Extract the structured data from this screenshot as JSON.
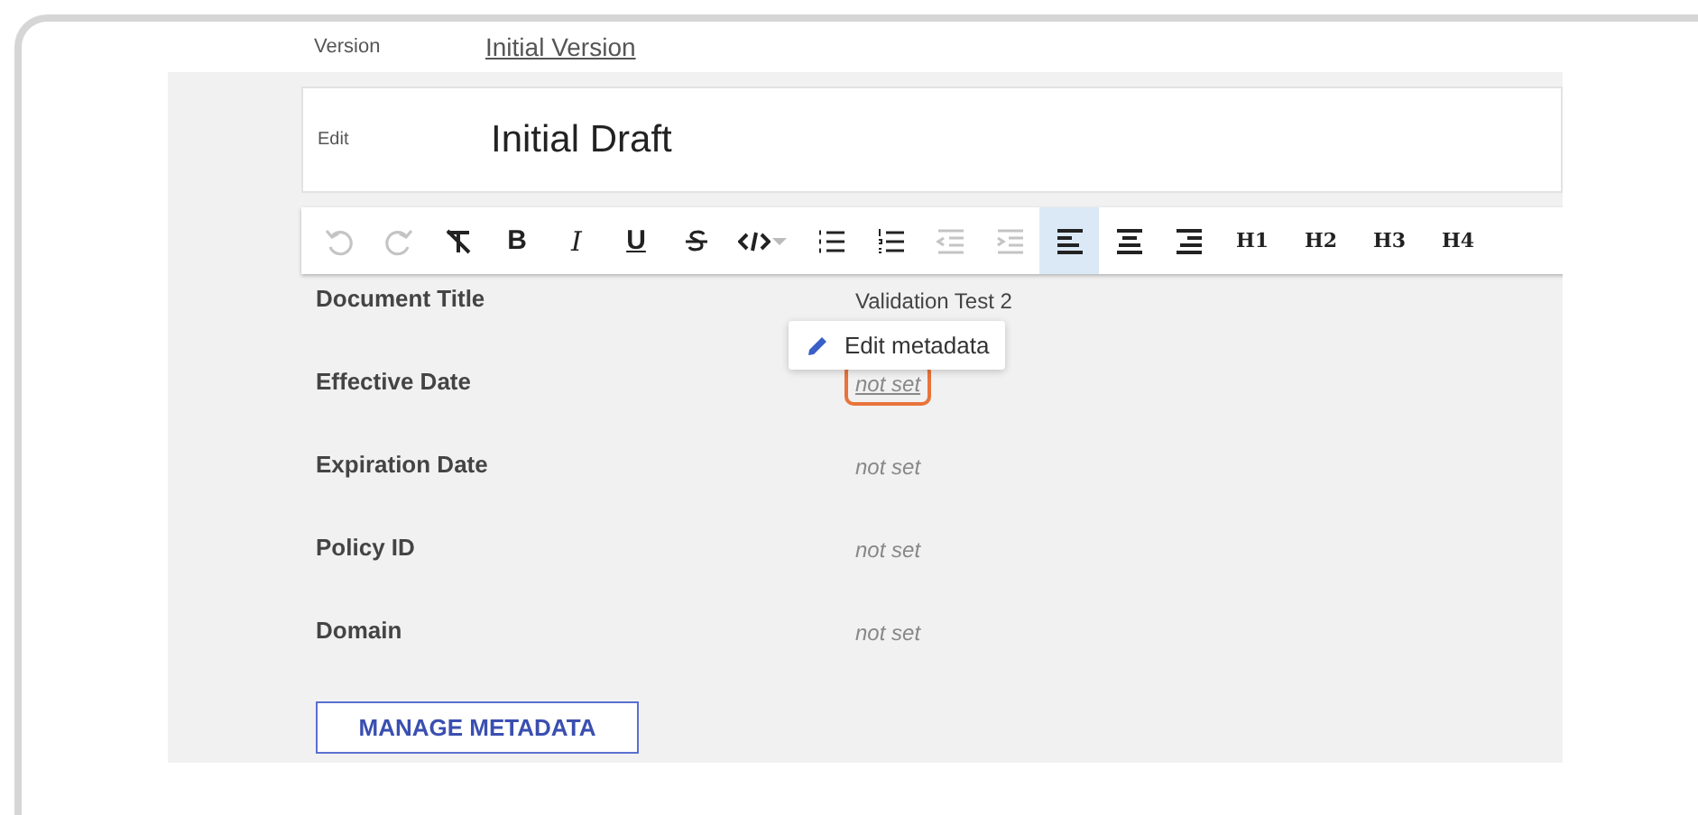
{
  "version": {
    "label": "Version",
    "value": "Initial Version"
  },
  "edit": {
    "label": "Edit",
    "value": "Initial Draft"
  },
  "toolbar": [
    {
      "kind": "undo",
      "disabled": true,
      "selected": false
    },
    {
      "kind": "redo",
      "disabled": true,
      "selected": false
    },
    {
      "kind": "clear-format",
      "disabled": false,
      "selected": false
    },
    {
      "kind": "bold",
      "label": "B",
      "disabled": false,
      "selected": false
    },
    {
      "kind": "italic",
      "label": "I",
      "disabled": false,
      "selected": false
    },
    {
      "kind": "underline",
      "label": "U",
      "disabled": false,
      "selected": false
    },
    {
      "kind": "strike",
      "disabled": false,
      "selected": false
    },
    {
      "kind": "code",
      "disabled": false,
      "selected": false
    },
    {
      "kind": "bullets",
      "disabled": false,
      "selected": false
    },
    {
      "kind": "numbers",
      "disabled": false,
      "selected": false
    },
    {
      "kind": "outdent",
      "disabled": true,
      "selected": false
    },
    {
      "kind": "indent",
      "disabled": true,
      "selected": false
    },
    {
      "kind": "align-left",
      "disabled": false,
      "selected": true
    },
    {
      "kind": "align-center",
      "disabled": false,
      "selected": false
    },
    {
      "kind": "align-right",
      "disabled": false,
      "selected": false
    },
    {
      "kind": "heading",
      "label": "H1",
      "disabled": false,
      "selected": false
    },
    {
      "kind": "heading",
      "label": "H2",
      "disabled": false,
      "selected": false
    },
    {
      "kind": "heading",
      "label": "H3",
      "disabled": false,
      "selected": false
    },
    {
      "kind": "heading",
      "label": "H4",
      "disabled": false,
      "selected": false
    }
  ],
  "metadata": [
    {
      "label": "Document Title",
      "value": "Validation Test 2",
      "is_set": true,
      "focused": false
    },
    {
      "label": "Effective Date",
      "value": "not set",
      "is_set": false,
      "focused": true
    },
    {
      "label": "Expiration Date",
      "value": "not set",
      "is_set": false,
      "focused": false
    },
    {
      "label": "Policy ID",
      "value": "not set",
      "is_set": false,
      "focused": false
    },
    {
      "label": "Domain",
      "value": "not set",
      "is_set": false,
      "focused": false
    }
  ],
  "tooltip": {
    "text": "Edit metadata"
  },
  "manage_button": "MANAGE METADATA"
}
